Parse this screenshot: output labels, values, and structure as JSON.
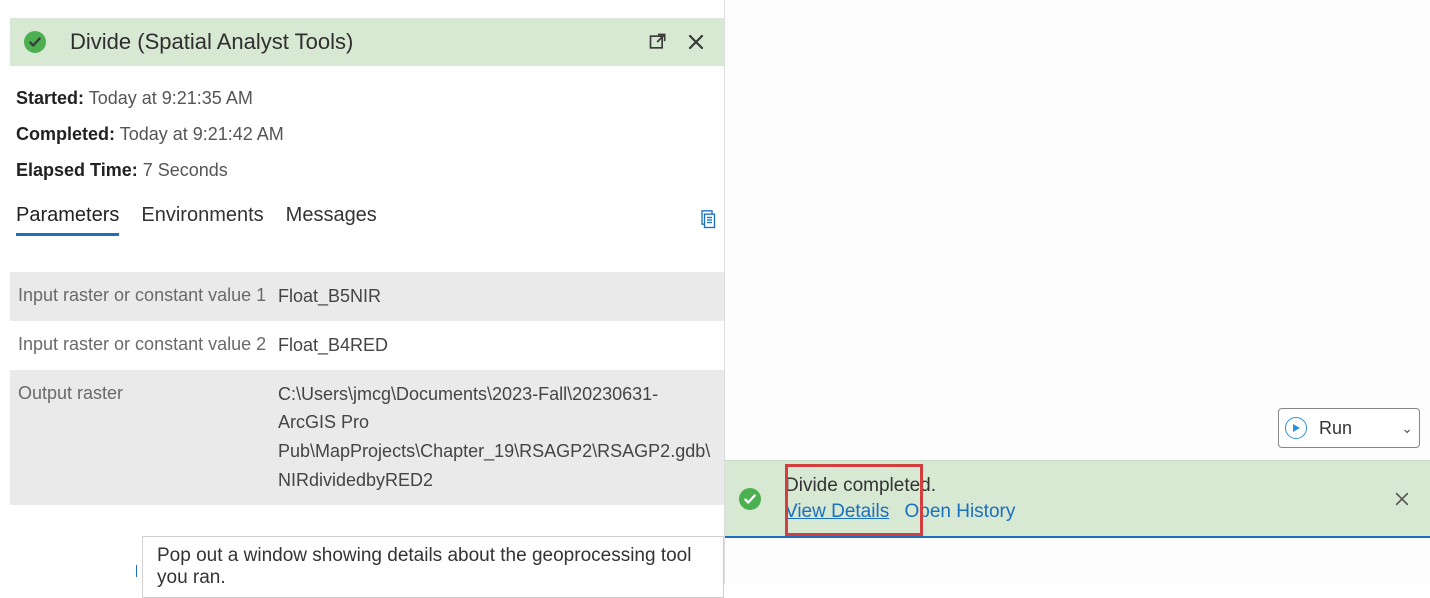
{
  "header": {
    "title": "Divide (Spatial Analyst Tools)"
  },
  "meta": {
    "started_label": "Started:",
    "started_value": "Today at 9:21:35 AM",
    "completed_label": "Completed:",
    "completed_value": "Today at 9:21:42 AM",
    "elapsed_label": "Elapsed Time:",
    "elapsed_value": "7 Seconds"
  },
  "tabs": {
    "parameters": "Parameters",
    "environments": "Environments",
    "messages": "Messages"
  },
  "params": [
    {
      "label": "Input raster or constant value 1",
      "value": "Float_B5NIR"
    },
    {
      "label": "Input raster or constant value 2",
      "value": "Float_B4RED"
    },
    {
      "label": "Output raster",
      "value": "C:\\Users\\jmcg\\Documents\\2023-Fall\\20230631-ArcGIS Pro Pub\\MapProjects\\Chapter_19\\RSAGP2\\RSAGP2.gdb\\NIRdividedbyRED2"
    }
  ],
  "run": {
    "label": "Run"
  },
  "status": {
    "message": "Divide completed.",
    "view_details": "View Details",
    "open_history": "Open History"
  },
  "tooltip": "Pop out a window showing details about the geoprocessing tool you ran."
}
